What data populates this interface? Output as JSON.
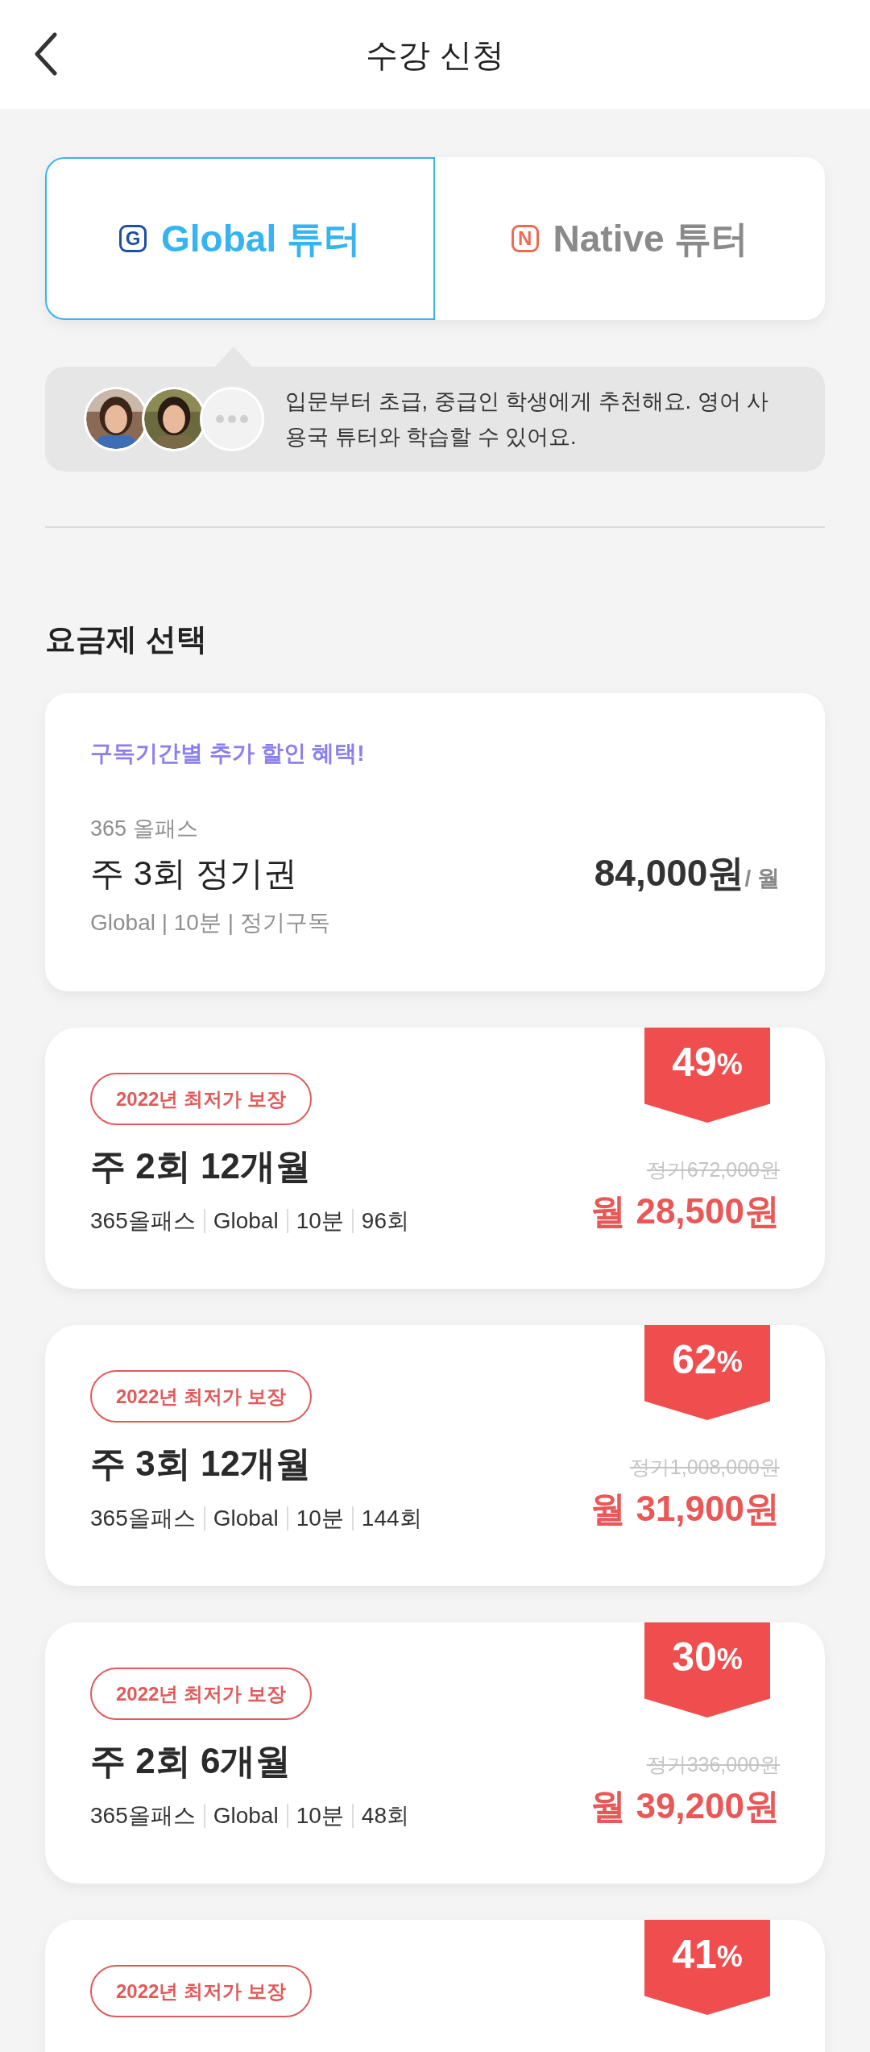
{
  "header": {
    "title": "수강 신청"
  },
  "tutor_tabs": [
    {
      "label": "Global 튜터",
      "mark": "G",
      "color": "#1f4ea6",
      "selected": true
    },
    {
      "label": "Native 튜터",
      "mark": "N",
      "color": "#ee6a55",
      "selected": false
    }
  ],
  "tutor_info": {
    "avatars": [
      {
        "kind": "picture"
      },
      {
        "kind": "picture"
      },
      {
        "kind": "more"
      }
    ],
    "text": "입문부터 초급, 중급인 학생에게 추천해요. 영어 사용국 튜터와 학습할 수 있어요."
  },
  "plan_section": {
    "title": "요금제 선택"
  },
  "plan_card": {
    "promo": "구독기간별 추가 할인 혜택!",
    "category": "365 올패스",
    "name": "주 3회 정기권",
    "details": "Global | 10분 | 정기구독",
    "price": "84,000원",
    "unit": "/ 월"
  },
  "offers": [
    {
      "badge": "2022년 최저가 보장",
      "discount": "49",
      "discount_unit": "%",
      "title": "주 2회 12개월",
      "tags": [
        "365올패스",
        "Global",
        "10분",
        "96회"
      ],
      "list_price": "정가672,000원",
      "price": "월 28,500원"
    },
    {
      "badge": "2022년 최저가 보장",
      "discount": "62",
      "discount_unit": "%",
      "title": "주 3회 12개월",
      "tags": [
        "365올패스",
        "Global",
        "10분",
        "144회"
      ],
      "list_price": "정가1,008,000원",
      "price": "월 31,900원"
    },
    {
      "badge": "2022년 최저가 보장",
      "discount": "30",
      "discount_unit": "%",
      "title": "주 2회 6개월",
      "tags": [
        "365올패스",
        "Global",
        "10분",
        "48회"
      ],
      "list_price": "정가336,000원",
      "price": "월 39,200원"
    },
    {
      "badge": "2022년 최저가 보장",
      "discount": "41",
      "discount_unit": "%"
    }
  ]
}
